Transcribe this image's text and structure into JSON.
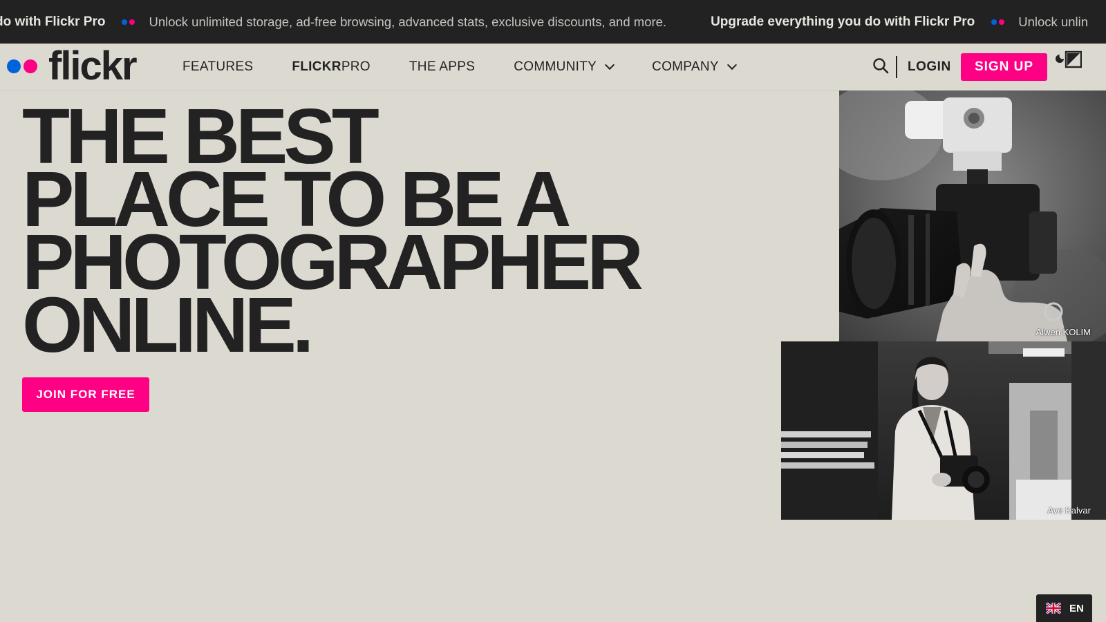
{
  "promo": {
    "bold_1": "you do with Flickr Pro",
    "text_1": "Unlock unlimited storage, ad-free browsing, advanced stats, exclusive discounts, and more.",
    "bold_2": "Upgrade everything you do with Flickr Pro",
    "text_2": "Unlock unlin"
  },
  "brand": {
    "name": "flickr",
    "blue": "#0063dc",
    "pink": "#ff0084"
  },
  "nav": {
    "features": "FEATURES",
    "flickrpro_bold": "FLICKR",
    "flickrpro_rest": "PRO",
    "apps": "THE APPS",
    "community": "COMMUNITY",
    "company": "COMPANY"
  },
  "header": {
    "login": "LOGIN",
    "signup": "SIGN UP"
  },
  "hero": {
    "headline": [
      "THE BEST",
      "PLACE TO BE A",
      "PHOTOGRAPHER",
      "ONLINE."
    ],
    "cta": "JOIN FOR FREE"
  },
  "photos": {
    "photo1_credit": "Alwen KOLIM",
    "photo2_credit": "Ave Kalvar"
  },
  "language": {
    "code": "EN"
  },
  "icons": [
    "search-icon",
    "theme-toggle-icon",
    "chevron-down-icon",
    "uk-flag-icon"
  ]
}
